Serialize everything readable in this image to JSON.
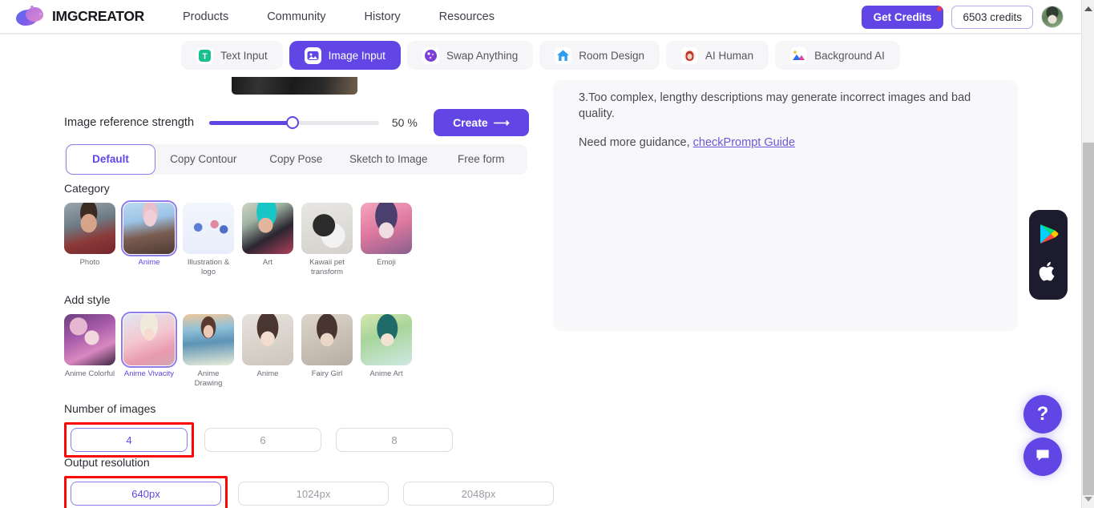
{
  "topnav": {
    "brand": "IMGCREATOR",
    "links": [
      {
        "label": "Products"
      },
      {
        "label": "Community"
      },
      {
        "label": "History"
      },
      {
        "label": "Resources"
      }
    ],
    "get_credits_label": "Get Credits",
    "credits_label": "6503 credits",
    "accent_color": "#6246e5"
  },
  "mode_tabs": [
    {
      "label": "Text Input",
      "icon": "text-input-icon",
      "active": false
    },
    {
      "label": "Image Input",
      "icon": "image-input-icon",
      "active": true
    },
    {
      "label": "Swap Anything",
      "icon": "swap-anything-icon",
      "active": false
    },
    {
      "label": "Room Design",
      "icon": "room-design-icon",
      "active": false
    },
    {
      "label": "AI Human",
      "icon": "ai-human-icon",
      "active": false
    },
    {
      "label": "Background AI",
      "icon": "background-ai-icon",
      "active": false
    }
  ],
  "strength": {
    "label": "Image reference strength",
    "value_label": "50 %",
    "value": 50,
    "create_label": "Create",
    "create_arrow": "⟶"
  },
  "subtabs": [
    {
      "label": "Default",
      "active": true
    },
    {
      "label": "Copy Contour",
      "active": false
    },
    {
      "label": "Copy Pose",
      "active": false
    },
    {
      "label": "Sketch to Image",
      "active": false
    },
    {
      "label": "Free form",
      "active": false
    }
  ],
  "category": {
    "title": "Category",
    "items": [
      {
        "label": "Photo",
        "selected": false
      },
      {
        "label": "Anime",
        "selected": true
      },
      {
        "label": "Illustration & logo",
        "selected": false
      },
      {
        "label": "Art",
        "selected": false
      },
      {
        "label": "Kawaii pet transform",
        "selected": false
      },
      {
        "label": "Emoji",
        "selected": false
      }
    ]
  },
  "add_style": {
    "title": "Add style",
    "items": [
      {
        "label": "Anime Colorful",
        "selected": false
      },
      {
        "label": "Anime Vivacity",
        "selected": true
      },
      {
        "label": "Anime Drawing",
        "selected": false
      },
      {
        "label": "Anime",
        "selected": false
      },
      {
        "label": "Fairy Girl",
        "selected": false
      },
      {
        "label": "Anime Art",
        "selected": false
      }
    ]
  },
  "number_of_images": {
    "title": "Number of images",
    "options": [
      {
        "label": "4",
        "selected": true,
        "highlighted": true
      },
      {
        "label": "6",
        "selected": false,
        "highlighted": false
      },
      {
        "label": "8",
        "selected": false,
        "highlighted": false
      }
    ]
  },
  "output_resolution": {
    "title": "Output resolution",
    "options": [
      {
        "label": "640px",
        "selected": true,
        "highlighted": true
      },
      {
        "label": "1024px",
        "selected": false,
        "highlighted": false
      },
      {
        "label": "2048px",
        "selected": false,
        "highlighted": false
      }
    ]
  },
  "guidance_panel": {
    "tip3": "3.Too complex, lengthy descriptions may generate incorrect images and bad quality.",
    "need_more_prefix": "Need more guidance, ",
    "link_label": "checkPrompt Guide"
  },
  "floating": {
    "google_play_icon": "google-play-icon",
    "apple_icon": "apple-icon",
    "help_label": "?",
    "chat_icon": "chat-bubble-icon"
  },
  "highlight_color": "#fb0505"
}
